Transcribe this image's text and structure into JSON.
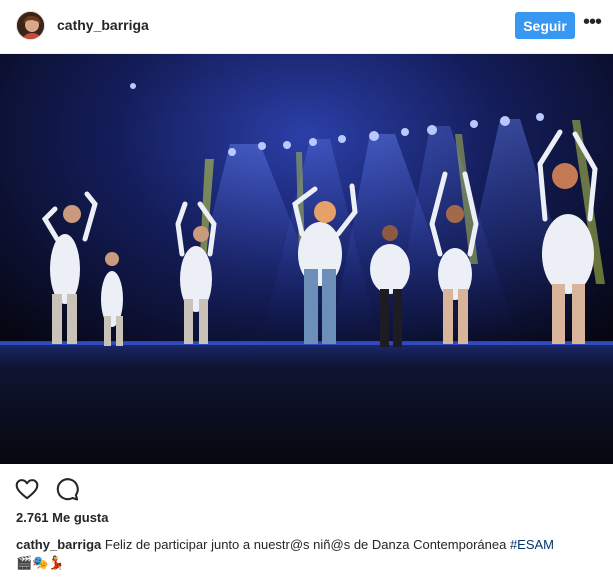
{
  "header": {
    "username": "cathy_barriga",
    "follow_label": "Seguir",
    "more_label": "•••"
  },
  "post": {
    "photo_alt": "",
    "likes_text": "2.761 Me gusta",
    "caption_user": "cathy_barriga",
    "caption_text": " Feliz de participar junto a nuestr@s niñ@s de Danza Contemporánea ",
    "caption_hashtag": "#ESAM",
    "caption_emojis": "🎬🎭💃"
  },
  "icons": {
    "avatar": "avatar-photo",
    "like": "heart-icon",
    "comment": "comment-bubble-icon",
    "more": "more-dots-icon"
  }
}
